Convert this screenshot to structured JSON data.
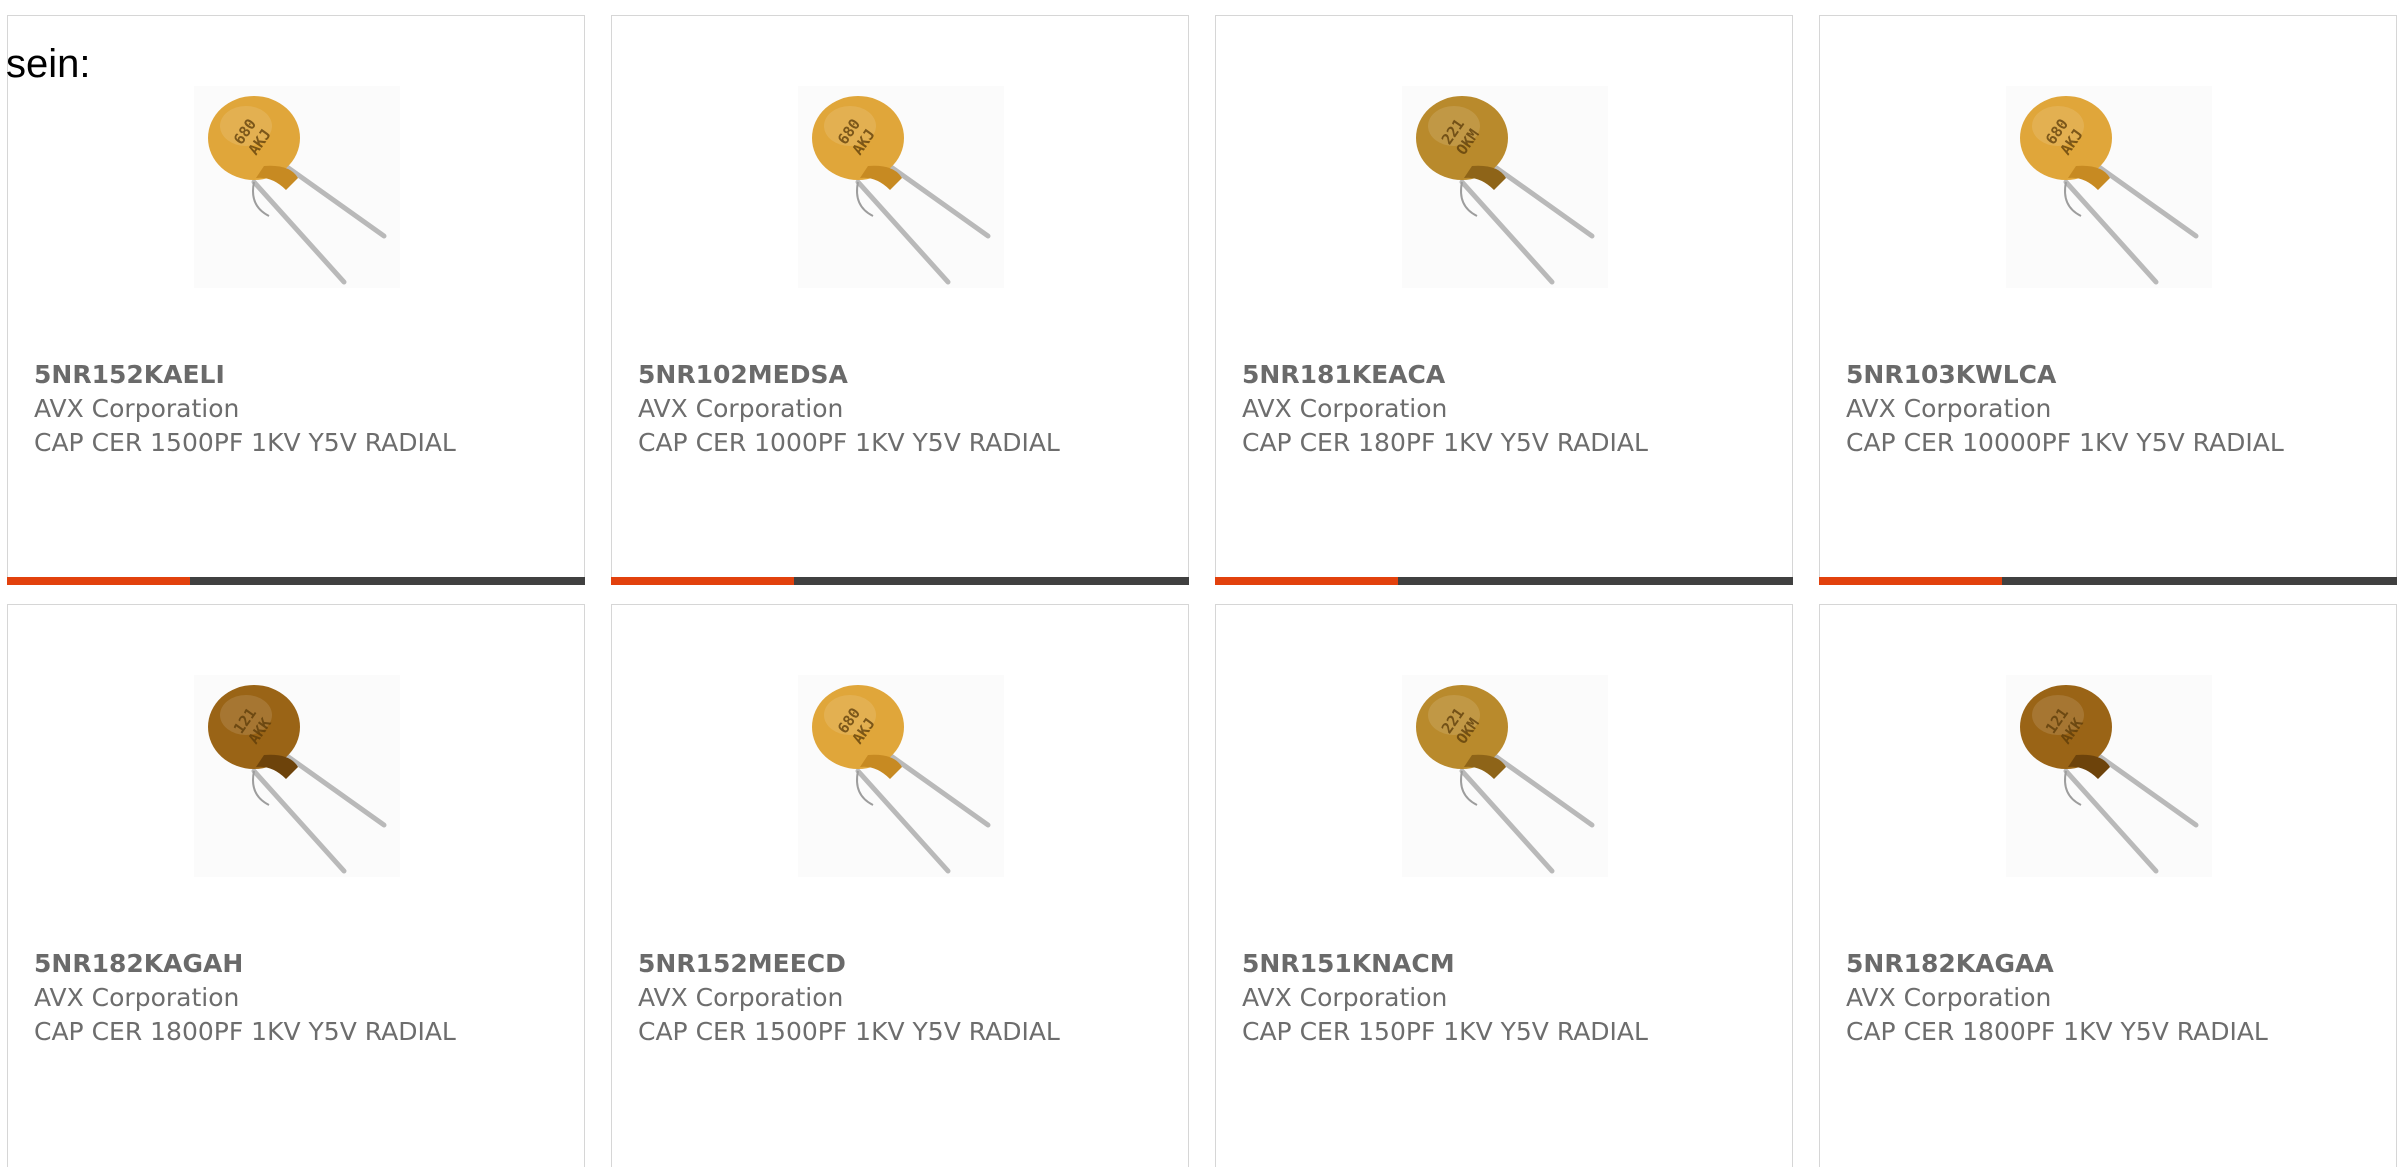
{
  "intro_text": "sein:",
  "colors": {
    "accent_orange": "#e2410d",
    "accent_dark": "#404040",
    "capacitor_orange": "#d79a2d",
    "capacitor_brown": "#8e5a14",
    "lead_gray": "#b9b9b9"
  },
  "products": [
    {
      "part_number": "5NR152KAELI",
      "manufacturer": "AVX Corporation",
      "description": "CAP CER 1500PF 1KV Y5V RADIAL",
      "marking": [
        "680",
        "AKJ"
      ],
      "capacitor_color": "orange",
      "icon": "ceramic-disc-capacitor-icon"
    },
    {
      "part_number": "5NR102MEDSA",
      "manufacturer": "AVX Corporation",
      "description": "CAP CER 1000PF 1KV Y5V RADIAL",
      "marking": [
        "680",
        "AKJ"
      ],
      "capacitor_color": "orange",
      "icon": "ceramic-disc-capacitor-icon"
    },
    {
      "part_number": "5NR181KEACA",
      "manufacturer": "AVX Corporation",
      "description": "CAP CER 180PF 1KV Y5V RADIAL",
      "marking": [
        "221",
        "OKM"
      ],
      "capacitor_color": "orange-brown",
      "icon": "ceramic-disc-capacitor-icon"
    },
    {
      "part_number": "5NR103KWLCA",
      "manufacturer": "AVX Corporation",
      "description": "CAP CER 10000PF 1KV Y5V RADIAL",
      "marking": [
        "680",
        "AKJ"
      ],
      "capacitor_color": "orange",
      "icon": "ceramic-disc-capacitor-icon"
    },
    {
      "part_number": "5NR182KAGAH",
      "manufacturer": "AVX Corporation",
      "description": "CAP CER 1800PF 1KV Y5V RADIAL",
      "marking": [
        "121",
        "AKK"
      ],
      "capacitor_color": "brown",
      "icon": "ceramic-disc-capacitor-icon"
    },
    {
      "part_number": "5NR152MEECD",
      "manufacturer": "AVX Corporation",
      "description": "CAP CER 1500PF 1KV Y5V RADIAL",
      "marking": [
        "680",
        "AKJ"
      ],
      "capacitor_color": "orange",
      "icon": "ceramic-disc-capacitor-icon"
    },
    {
      "part_number": "5NR151KNACM",
      "manufacturer": "AVX Corporation",
      "description": "CAP CER 150PF 1KV Y5V RADIAL",
      "marking": [
        "221",
        "OKM"
      ],
      "capacitor_color": "orange-brown",
      "icon": "ceramic-disc-capacitor-icon"
    },
    {
      "part_number": "5NR182KAGAA",
      "manufacturer": "AVX Corporation",
      "description": "CAP CER 1800PF 1KV Y5V RADIAL",
      "marking": [
        "121",
        "AKK"
      ],
      "capacitor_color": "brown",
      "icon": "ceramic-disc-capacitor-icon"
    }
  ]
}
